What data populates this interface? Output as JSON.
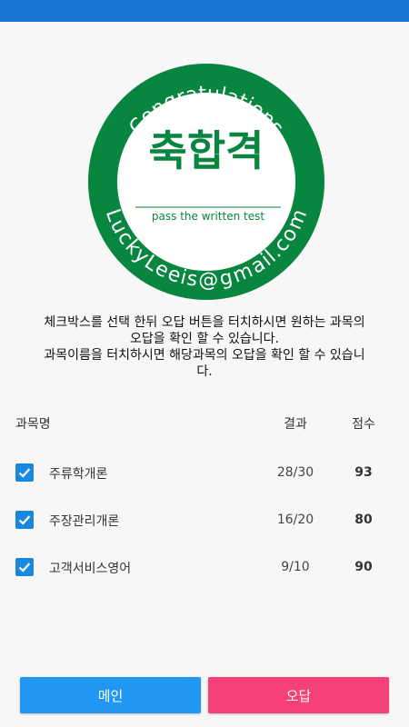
{
  "stamp": {
    "top_text": "Congratulations",
    "center_text": "축합격",
    "sub_text": "pass the written test",
    "bottom_text": "LuckyLeeis@gmail.com",
    "color": "#08853e"
  },
  "description": {
    "line1": "체크박스를 선택 한뒤 오답 버튼을 터치하시면 원하는 과목의",
    "line2": "오답을 확인 할 수 있습니다.",
    "line3": "과목이름을 터치하시면 해당과목의 오답을 확인 할 수 있습니",
    "line4": "다."
  },
  "table": {
    "headers": {
      "subject": "과목명",
      "result": "결과",
      "score": "점수"
    },
    "rows": [
      {
        "subject": "주류학개론",
        "result": "28/30",
        "score": "93",
        "checked": true
      },
      {
        "subject": "주장관리개론",
        "result": "16/20",
        "score": "80",
        "checked": true
      },
      {
        "subject": "고객서비스영어",
        "result": "9/10",
        "score": "90",
        "checked": true
      }
    ]
  },
  "buttons": {
    "main": "메인",
    "wrong": "오답"
  },
  "colors": {
    "statusbar": "#1976d2",
    "checkbox": "#1a88e0",
    "main_button": "#2196f3",
    "wrong_button": "#f4417a"
  }
}
